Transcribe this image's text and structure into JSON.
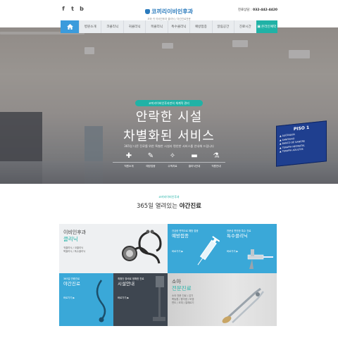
{
  "header": {
    "social": [
      "f",
      "t",
      "b"
    ],
    "logo_main": "코끼리이비인후과",
    "logo_sub": "코와 귀 이비인후과 클리닉 / 야간진료전문",
    "phone_label": "진료상담 :",
    "phone_number": "032-442-4420"
  },
  "nav": {
    "home_icon": "home-icon",
    "items": [
      "병원소개",
      "코클리닉",
      "귀클리닉",
      "목클리닉",
      "특수클리닉",
      "예방접종",
      "알림공간"
    ],
    "hours": "진료시간",
    "online": "온라인예약"
  },
  "hero": {
    "badge": "코끼리이비인후과만의 체계적 관리",
    "line1": "안락한 시설",
    "line2": "차별화된 서비스",
    "desc": "365일 다른 진료를 위한 특별한 시설과 편안한 서비스를 안내해 드립니다",
    "icons": [
      {
        "name": "hospital-icon",
        "glyph": "✚",
        "label": "직원소개"
      },
      {
        "name": "syringe-icon",
        "glyph": "✎",
        "label": "예방접종"
      },
      {
        "name": "medicine-icon",
        "glyph": "✧",
        "label": "수액치료"
      },
      {
        "name": "pill-icon",
        "glyph": "▬",
        "label": "클리닉안내"
      },
      {
        "name": "flask-icon",
        "glyph": "⚗",
        "label": "직원안내"
      }
    ],
    "sign": {
      "title": "PISO 1",
      "rows": [
        "▲ ASCENSOR",
        "▲ SANITARIO",
        "▲ BANCO DE SANGRE",
        "▲ TERAPIA NEONATAL",
        "▲ TERAPIA ADULTOS"
      ]
    }
  },
  "section": {
    "kicker": "코끼리이비인후과",
    "title_pre": "365일 열려있는",
    "title_bold": "야간진료"
  },
  "cards": [
    {
      "key": "ent",
      "t1": "이비인후과",
      "t2": "클리닉",
      "small": [
        "귀클리닉 / 코클리닉",
        "목클리닉 / 특수클리닉"
      ],
      "more": "",
      "theme": "light"
    },
    {
      "key": "vaccine",
      "t1": "예방접종",
      "small": [
        "건강한 면역으로 예방 접종",
        "건강 관리"
      ],
      "more": "바로가기 ▶",
      "theme": "blue"
    },
    {
      "key": "special",
      "t1": "특수클리닉",
      "small": [
        "전문성 편안한 특수 진료",
        "특수클리닉"
      ],
      "more": "바로가기 ▶",
      "theme": "blue"
    },
    {
      "key": "night",
      "t1": "야간진료",
      "small": [
        "365일 연중진료"
      ],
      "more": "바로가기 ▶",
      "theme": "blue"
    },
    {
      "key": "facility",
      "t1": "시설안내",
      "small": [
        "최첨단 장비로 정확한 진료"
      ],
      "more": "바로가기 ▶",
      "theme": "dark"
    },
    {
      "key": "kids",
      "t1": "소아",
      "t2": "전문진료",
      "small": [
        "소아 전문 진료 / 감기",
        "축농증 / 중이염 / 비염",
        "편도 / 코피 / 알레르기"
      ],
      "more": "바로가기 ▶",
      "theme": "gray"
    }
  ],
  "colors": {
    "teal": "#20b2a6",
    "blue": "#3aa8d8",
    "dark": "#3e4650",
    "light": "#eef0f2"
  }
}
